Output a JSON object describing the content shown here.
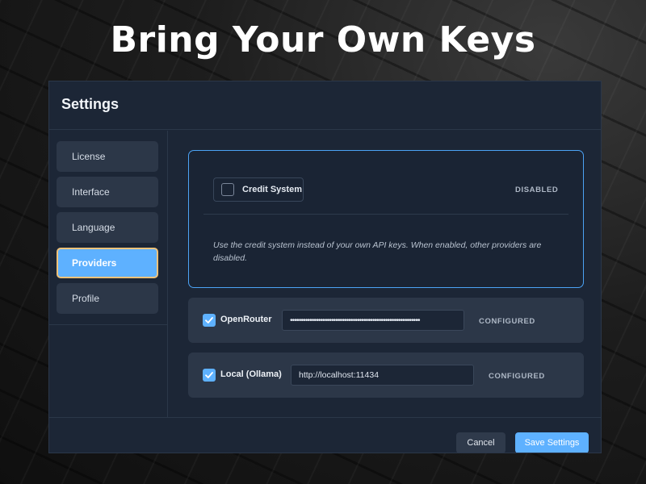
{
  "headline": "Bring Your Own Keys",
  "window": {
    "title": "Settings"
  },
  "sidebar": {
    "items": [
      {
        "label": "License",
        "active": false
      },
      {
        "label": "Interface",
        "active": false
      },
      {
        "label": "Language",
        "active": false
      },
      {
        "label": "Providers",
        "active": true
      },
      {
        "label": "Profile",
        "active": false
      }
    ]
  },
  "credit_system": {
    "label": "Credit System",
    "checked": false,
    "status": "DISABLED",
    "description": "Use the credit system instead of your own API keys. When enabled, other providers are disabled."
  },
  "providers": [
    {
      "label": "OpenRouter",
      "checked": true,
      "value": "••••••••••••••••••••••••••••••••••••••••••••••••••••••••••••",
      "status": "CONFIGURED"
    },
    {
      "label": "Local (Ollama)",
      "checked": true,
      "value": "http://localhost:11434",
      "status": "CONFIGURED"
    }
  ],
  "footer": {
    "cancel_label": "Cancel",
    "save_label": "Save Settings"
  },
  "colors": {
    "accent": "#5eb1ff",
    "active_border": "#f0c27a",
    "window_bg": "#1c2636",
    "card_bg": "#2c3748"
  }
}
